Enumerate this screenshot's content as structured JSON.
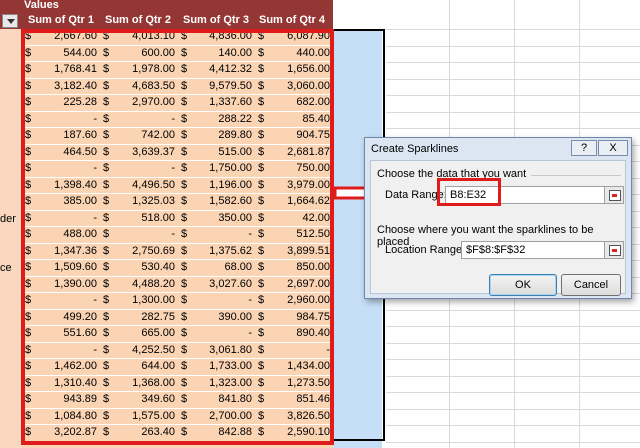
{
  "pivot": {
    "values_label": "Values",
    "headers": [
      "Sum of Qtr 1",
      "Sum of Qtr 2",
      "Sum of Qtr 3",
      "Sum of Qtr 4"
    ],
    "currency": "$",
    "row_label_fragments": [
      {
        "row": 11,
        "text": "der"
      },
      {
        "row": 14,
        "text": "ce"
      }
    ],
    "rows": [
      [
        "2,667.60",
        "4,013.10",
        "4,836.00",
        "6,087.90"
      ],
      [
        "544.00",
        "600.00",
        "140.00",
        "440.00"
      ],
      [
        "1,768.41",
        "1,978.00",
        "4,412.32",
        "1,656.00"
      ],
      [
        "3,182.40",
        "4,683.50",
        "9,579.50",
        "3,060.00"
      ],
      [
        "225.28",
        "2,970.00",
        "1,337.60",
        "682.00"
      ],
      [
        "-",
        "-",
        "288.22",
        "85.40"
      ],
      [
        "187.60",
        "742.00",
        "289.80",
        "904.75"
      ],
      [
        "464.50",
        "3,639.37",
        "515.00",
        "2,681.87"
      ],
      [
        "-",
        "-",
        "1,750.00",
        "750.00"
      ],
      [
        "1,398.40",
        "4,496.50",
        "1,196.00",
        "3,979.00"
      ],
      [
        "385.00",
        "1,325.03",
        "1,582.60",
        "1,664.62"
      ],
      [
        "-",
        "518.00",
        "350.00",
        "42.00"
      ],
      [
        "488.00",
        "-",
        "-",
        "512.50"
      ],
      [
        "1,347.36",
        "2,750.69",
        "1,375.62",
        "3,899.51"
      ],
      [
        "1,509.60",
        "530.40",
        "68.00",
        "850.00"
      ],
      [
        "1,390.00",
        "4,488.20",
        "3,027.60",
        "2,697.00"
      ],
      [
        "-",
        "1,300.00",
        "-",
        "2,960.00"
      ],
      [
        "499.20",
        "282.75",
        "390.00",
        "984.75"
      ],
      [
        "551.60",
        "665.00",
        "-",
        "890.40"
      ],
      [
        "-",
        "4,252.50",
        "3,061.80",
        "-"
      ],
      [
        "1,462.00",
        "644.00",
        "1,733.00",
        "1,434.00"
      ],
      [
        "1,310.40",
        "1,368.00",
        "1,323.00",
        "1,273.50"
      ],
      [
        "943.89",
        "349.60",
        "841.80",
        "851.46"
      ],
      [
        "1,084.80",
        "1,575.00",
        "2,700.00",
        "3,826.50"
      ],
      [
        "3,202.87",
        "263.40",
        "842.88",
        "2,590.10"
      ]
    ]
  },
  "dialog": {
    "title": "Create Sparklines",
    "help_label": "?",
    "close_label": "X",
    "section_data": "Choose the data that you want",
    "data_range_label": "Data Range:",
    "data_range_value": "B8:E32",
    "section_location": "Choose where you want the sparklines to be placed",
    "location_range_label": "Location Range:",
    "location_range_value": "$F$8:$F$32",
    "ok_label": "OK",
    "cancel_label": "Cancel"
  },
  "colors": {
    "header_bg": "#943634",
    "data_bg": "#fbd4b4",
    "highlight_red": "#e01b1b",
    "selection_blue": "#c6dff7",
    "dialog_bg": "#dce6f2"
  },
  "icons": [
    "dropdown-arrow-icon",
    "range-picker-icon",
    "arrow-pointer-icon"
  ]
}
